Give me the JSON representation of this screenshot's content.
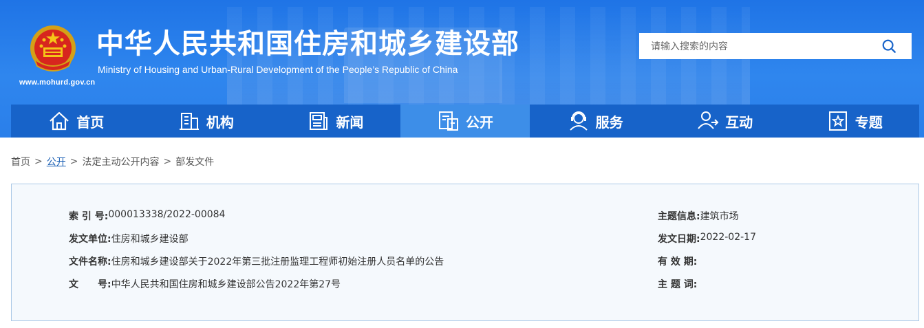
{
  "header": {
    "title_cn": "中华人民共和国住房和城乡建设部",
    "title_en": "Ministry of Housing and Urban-Rural Development of the People’s Republic of China",
    "site_url": "www.mohurd.gov.cn",
    "search_placeholder": "请输入搜索的内容",
    "search_icon": "search-icon"
  },
  "nav": {
    "items": [
      {
        "label": "首页",
        "icon": "home-icon"
      },
      {
        "label": "机构",
        "icon": "building-icon"
      },
      {
        "label": "新闻",
        "icon": "news-icon"
      },
      {
        "label": "公开",
        "icon": "documents-icon",
        "active": true
      },
      {
        "label": "服务",
        "icon": "service-agent-icon"
      },
      {
        "label": "互动",
        "icon": "interaction-icon"
      },
      {
        "label": "专题",
        "icon": "star-frame-icon"
      }
    ]
  },
  "breadcrumb": {
    "items": [
      "首页",
      "公开",
      "法定主动公开内容",
      "部发文件"
    ],
    "separator": ">"
  },
  "info": {
    "index_label": "索 引 号:",
    "index_value": "000013338/2022-00084",
    "topic_label": "主题信息:",
    "topic_value": "建筑市场",
    "issuer_label": "发文单位:",
    "issuer_value": "住房和城乡建设部",
    "date_label": "发文日期:",
    "date_value": "2022-02-17",
    "name_label": "文件名称:",
    "name_value": "住房和城乡建设部关于2022年第三批注册监理工程师初始注册人员名单的公告",
    "validity_label": "有 效 期:",
    "validity_value": "",
    "docno_label": "文　　号:",
    "docno_value": "中华人民共和国住房和城乡建设部公告2022年第27号",
    "keywords_label": "主 题 词:",
    "keywords_value": ""
  },
  "colors": {
    "header_blue": "#1f74e6",
    "nav_blue": "#1763c9",
    "nav_active": "#3d8ee8",
    "link_blue": "#1a5fb4",
    "box_border": "#a9c7e6",
    "box_bg": "#f5f9fd"
  }
}
